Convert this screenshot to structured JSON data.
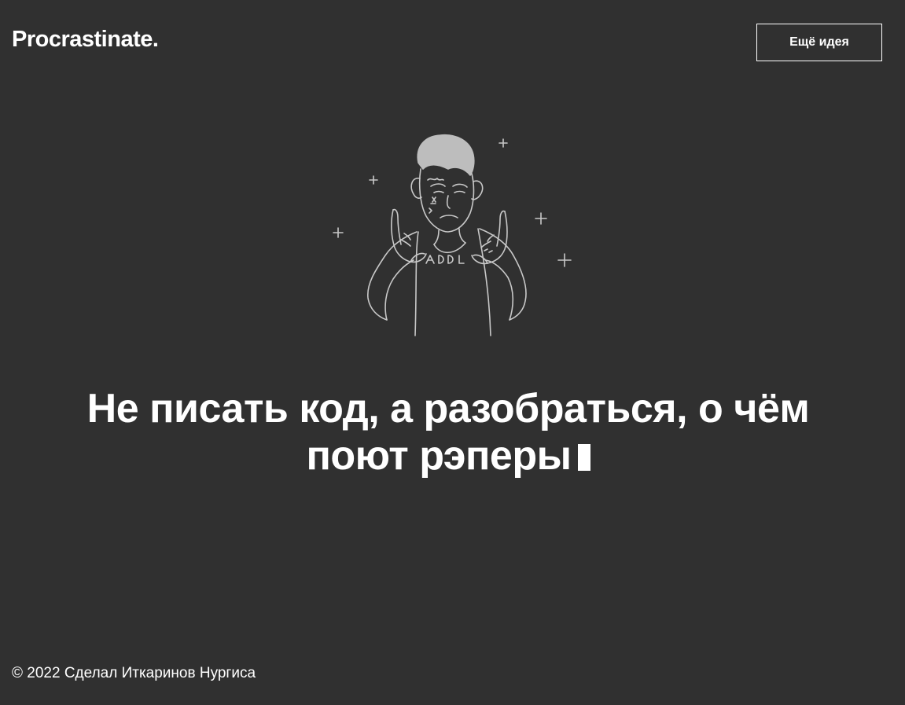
{
  "header": {
    "logo": "Procrastinate.",
    "more_button_label": "Ещё идея"
  },
  "main": {
    "illustration_icon": "rapper-drawing-icon",
    "idea_text": "Не писать код, а разобраться, о чём поют рэперы"
  },
  "footer": {
    "copyright": "© 2022 Сделал Иткаринов Нургиса"
  },
  "colors": {
    "background": "#303030",
    "text": "#ffffff",
    "illustration_stroke": "#c8c8c8"
  }
}
